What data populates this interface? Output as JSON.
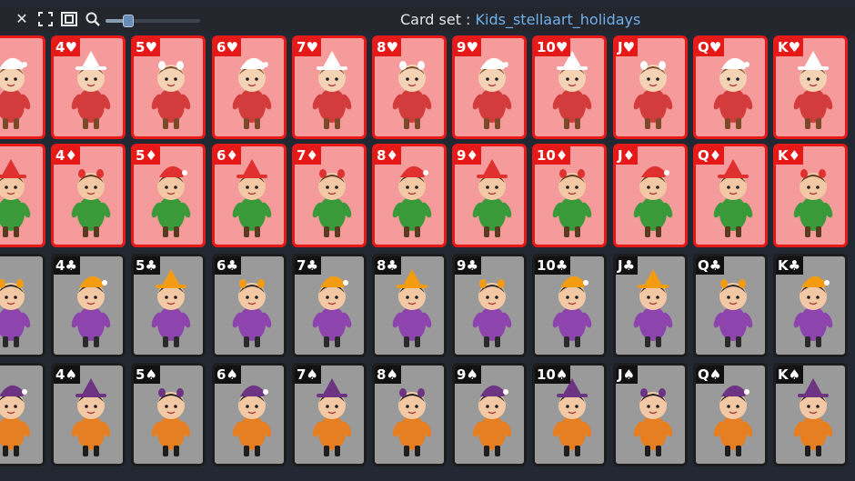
{
  "toolbar": {
    "buttons": [
      {
        "name": "close-button",
        "icon": "close-icon",
        "glyph": "✕"
      },
      {
        "name": "fullscreen-button",
        "icon": "fullscreen-icon"
      },
      {
        "name": "window-button",
        "icon": "window-icon"
      },
      {
        "name": "zoom-button",
        "icon": "magnifier-icon"
      }
    ],
    "zoom_level": 0.2,
    "title_label": "Card set : ",
    "set_name": "Kids_stellaart_holidays"
  },
  "colors": {
    "red_card_bg": "#f59b9b",
    "red_card_border": "#e61919",
    "black_card_bg": "#9a9a9a",
    "black_card_border": "#1d1d1d",
    "accent": "#6fb0ea"
  },
  "rows": [
    {
      "suit": "hearts",
      "symbol": "♥",
      "color": "red",
      "ranks": [
        "",
        "4",
        "5",
        "6",
        "7",
        "8",
        "9",
        "10",
        "J",
        "Q",
        "K"
      ]
    },
    {
      "suit": "diamonds",
      "symbol": "♦",
      "color": "red",
      "ranks": [
        "",
        "4",
        "5",
        "6",
        "7",
        "8",
        "9",
        "10",
        "J",
        "Q",
        "K"
      ]
    },
    {
      "suit": "clubs",
      "symbol": "♣",
      "color": "black",
      "ranks": [
        "",
        "4",
        "5",
        "6",
        "7",
        "8",
        "9",
        "10",
        "J",
        "Q",
        "K"
      ]
    },
    {
      "suit": "spades",
      "symbol": "♠",
      "color": "black",
      "ranks": [
        "",
        "4",
        "5",
        "6",
        "7",
        "8",
        "9",
        "10",
        "J",
        "Q",
        "K"
      ]
    }
  ]
}
